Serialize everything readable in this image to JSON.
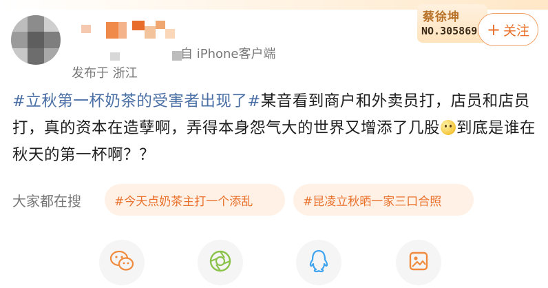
{
  "post": {
    "source": "自 iPhone客户端",
    "location": "发布于 浙江",
    "hashtag": "#立秋第一杯奶茶的受害者出现了#",
    "body_before_emoji": "某音看到商户和外卖员打，店员和店员打，真的资本在造孽啊，弄得本身怨气大的世界又增添了几股",
    "emoji_icon": "smile-emoji",
    "body_after_emoji": "到底是谁在秋天的第一杯啊？？"
  },
  "badge": {
    "name": "蔡徐坤",
    "number": "NO.305869"
  },
  "follow_button": {
    "plus": "+",
    "label": "关注"
  },
  "search": {
    "label": "大家都在搜",
    "tags": [
      "#今天点奶茶主打一个添乱",
      "#昆凌立秋晒一家三口合照"
    ]
  },
  "share_icons": [
    "wechat-icon",
    "moments-icon",
    "qq-icon",
    "save-image-icon"
  ],
  "colors": {
    "hashtag": "#4a6fa5",
    "accent": "#e8702a",
    "tag_background": "#fff1e6",
    "muted_text": "#777777"
  }
}
